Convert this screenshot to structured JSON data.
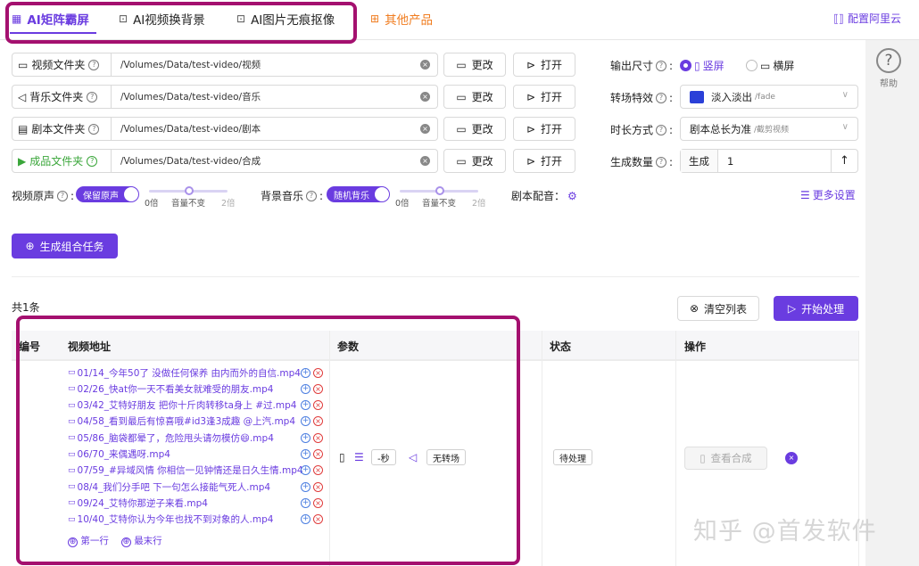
{
  "tabs": [
    {
      "label": "AI矩阵霸屏",
      "icon": "grid-icon"
    },
    {
      "label": "AI视频换背景",
      "icon": "frame-icon"
    },
    {
      "label": "AI图片无痕抠像",
      "icon": "frame-icon"
    },
    {
      "label": "其他产品",
      "icon": "apps-icon"
    }
  ],
  "top_right": "配置阿里云",
  "help_label": "帮助",
  "folders": [
    {
      "label": "视频文件夹",
      "path": "/Volumes/Data/test-video/视频"
    },
    {
      "label": "背乐文件夹",
      "path": "/Volumes/Data/test-video/音乐"
    },
    {
      "label": "剧本文件夹",
      "path": "/Volumes/Data/test-video/剧本"
    },
    {
      "label": "成品文件夹",
      "path": "/Volumes/Data/test-video/合成"
    }
  ],
  "btn_change": "更改",
  "btn_open": "打开",
  "settings": {
    "output_size_label": "输出尺寸",
    "portrait": "竖屏",
    "landscape": "横屏",
    "transition_label": "转场特效",
    "transition_value": "淡入淡出",
    "transition_sub": "/fade",
    "duration_label": "时长方式",
    "duration_value": "剧本总长为准",
    "duration_sub": "/截剪视频",
    "count_label": "生成数量",
    "count_prefix": "生成",
    "count_value": "1",
    "count_up": "↑"
  },
  "audio": {
    "orig_label": "视频原声",
    "orig_toggle": "保留原声",
    "bg_label": "背景音乐",
    "bg_toggle": "随机背乐",
    "tick_0": "0倍",
    "tick_mid": "音量不变",
    "tick_2": "2倍",
    "script_voice": "剧本配音：",
    "more_settings": "更多设置"
  },
  "gen_task": "生成组合任务",
  "count_total": "共1条",
  "clear_list": "清空列表",
  "start_process": "开始处理",
  "table": {
    "headers": [
      "编号",
      "视频地址",
      "参数",
      "状态",
      "操作"
    ],
    "videos": [
      "01/14_今年50了 没做任何保养 由内而外的自信.mp4",
      "02/26_快at你一天不看美女就难受的朋友.mp4",
      "03/42_艾特好朋友 把你十斤肉转移ta身上 #过.mp4",
      "04/58_看到最后有惊喜哦#id3逢3成趣 @上汽.mp4",
      "05/86_脑袋都晕了，危险甩头请勿模仿😄.mp4",
      "06/70_来偶遇呀.mp4",
      "07/59_#异域风情 你相信一见钟情还是日久生情.mp4",
      "08/4_我们分手吧 下一句怎么接能气死人.mp4",
      "09/24_艾特你那逆子来看.mp4",
      "10/40_艾特你认为今年也找不到对象的人.mp4"
    ],
    "first_row": "第一行",
    "last_row": "最末行",
    "param_duration": "-秒",
    "param_transition": "无转场",
    "status": "待处理",
    "view_btn": "查看合成"
  },
  "watermark": "知乎 @首发软件"
}
